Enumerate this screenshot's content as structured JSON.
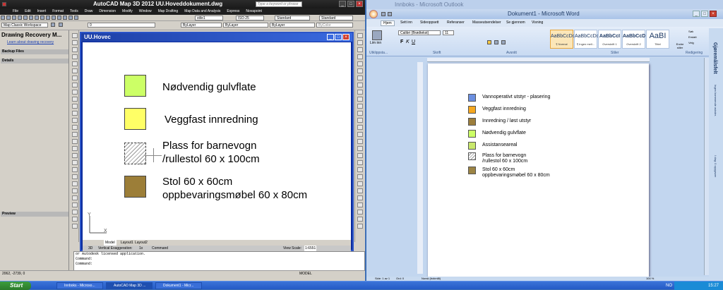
{
  "autocad": {
    "title": "AutoCAD Map 3D 2012    UU.Hoveddokument.dwg",
    "search_placeholder": "Type a keyword or phrase",
    "menu": [
      "File",
      "Edit",
      "Insert",
      "Format",
      "Tools",
      "Draw",
      "Dimension",
      "Modify",
      "Window",
      "Map Drafting",
      "Map Data and Analysis",
      "Express",
      "Novapoint"
    ],
    "dropdowns": {
      "style": "stile1",
      "dimstyle": "ISO-25",
      "textstyle": "Standard",
      "tablestyle": "Standard",
      "workspace": "Map Classic Workspace",
      "layer": "0",
      "color": "ByLayer",
      "linetype": "ByLayer",
      "lineweight": "ByLayer",
      "plotstyle": "ByColor"
    },
    "recovery_title": "Drawing Recovery M...",
    "recovery_link": "Learn about drawing recovery",
    "palette_sections": [
      "Backup Files",
      "Details",
      "Preview"
    ],
    "drawing_window_title": "UU.Hovec",
    "legend": [
      {
        "label": "Nødvendig gulvflate",
        "color": "#ccff66",
        "pattern": "solid"
      },
      {
        "label": "Veggfast innredning",
        "color": "#ffff66",
        "pattern": "solid"
      },
      {
        "label": "Plass for barnevogn\n/rullestol 60 x 100cm",
        "color": "#ffffff",
        "pattern": "hatch"
      },
      {
        "label": "Stol 60 x 60cm\noppbevaringsmøbel 60 x 80cm",
        "color": "#9c7e38",
        "pattern": "solid"
      }
    ],
    "ucs_labels": {
      "y": "Y",
      "x": "X"
    },
    "layout_tabs": [
      "Model",
      "Layout1",
      "Layout2"
    ],
    "status_items": [
      "3D",
      "Vertical Exaggeration:",
      "1x",
      "Command"
    ],
    "view_scale": "View Scale:",
    "view_scale_value": "1:6551",
    "command_lines": [
      "or Autodesk licensed application.",
      "Command:",
      "Command:"
    ],
    "coords": "2062, -2739, 0",
    "model_label": "MODEL"
  },
  "outlook_title": "Innboks - Microsoft Outlook",
  "word": {
    "title": "Dokument1 - Microsoft Word",
    "tabs": [
      "Hjem",
      "Sett inn",
      "Sideoppsett",
      "Referanser",
      "Masseutsendelser",
      "Se gjennom",
      "Visning"
    ],
    "font": "Calibri (Brødtekst)",
    "font_size": "11",
    "groups": [
      "Utklippsta...",
      "Skrift",
      "Avsnitt",
      "Stiler",
      "Redigering"
    ],
    "paste_label": "Lim inn",
    "styles": [
      {
        "sample": "AaBbCcDdE",
        "name": "¶ Normal"
      },
      {
        "sample": "AaBbCcDdE",
        "name": "¶ Ingen mell..."
      },
      {
        "sample": "AaBbCcI",
        "name": "Overskrift 1"
      },
      {
        "sample": "AaBbCcD",
        "name": "Overskrift 2"
      },
      {
        "sample": "AaBI",
        "name": "Tittel"
      }
    ],
    "change_styles": "Endre stiler",
    "editing": [
      "Søk",
      "Erstatt",
      "Velg"
    ],
    "legend": [
      {
        "label": "Vannoperativt utstyr - plasering",
        "color": "#6b8fe0"
      },
      {
        "label": "Veggfast innredning",
        "color": "#f6a81f"
      },
      {
        "label": "Innredning / løst utstyr",
        "color": "#9c7e3c"
      },
      {
        "label": "Nødvendig gulvflate",
        "color": "#ccff66"
      },
      {
        "label": "Assistanseareal",
        "color": "#c9e86c"
      },
      {
        "label": "Plass for barnevogn\n/rullestol 60 x 100cm",
        "color": "#ffffff",
        "pattern": "hatch"
      },
      {
        "label": "Stol 60 x 60cm\noppbevaringsmøbel 60 x 80cm",
        "color": "#9c8444"
      }
    ],
    "sidebar_labels": [
      "Gjøremålsfelt",
      "Ingen kommende avtaler.",
      "I dag: 0 oppgaver"
    ],
    "status": [
      "Side: 1 av 1",
      "Ord: 0",
      "Norsk (bokmål)"
    ],
    "zoom": "100 %"
  },
  "taskbar": {
    "start": "Start",
    "tasks": [
      "Innboks - Microso...",
      "AutoCAD Map 3D ...",
      "Dokument1 - Micr..."
    ],
    "lang": "NO",
    "clock": "15:27"
  }
}
